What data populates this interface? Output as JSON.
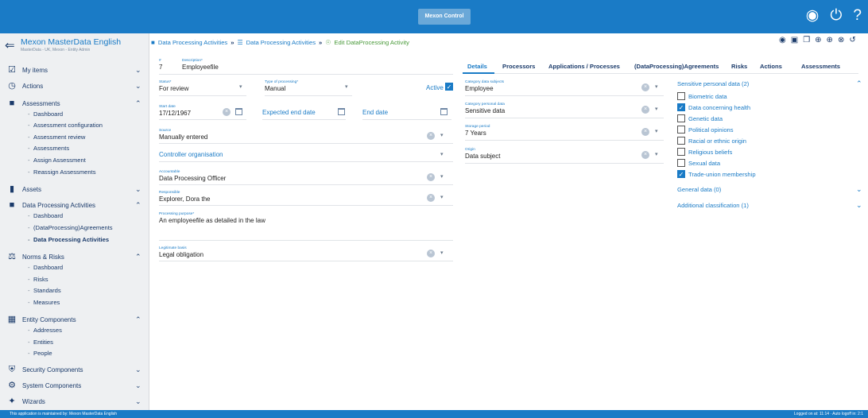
{
  "header": {
    "logo_text": "Mexon Control",
    "icons": [
      "user-icon",
      "power-icon",
      "help-icon"
    ]
  },
  "sidebar": {
    "title": "Mexon MasterData English",
    "subtitle": "MasterData - UK, Mexon - Entity Admin",
    "items": [
      {
        "label": "My items",
        "icon": "clipboard-check-icon"
      },
      {
        "label": "Actions",
        "icon": "alarm-clock-icon"
      },
      {
        "label": "Assessments",
        "icon": "chat-alert-icon",
        "sub": [
          "Dashboard",
          "Assessment configuration",
          "Assessment review",
          "Assessments",
          "Assign Assessment",
          "Reassign Assessments"
        ]
      },
      {
        "label": "Assets",
        "icon": "barcode-icon"
      },
      {
        "label": "Data Processing Activities",
        "icon": "chat-icon",
        "sub": [
          "Dashboard",
          "(DataProcessing)Agreements",
          "Data Processing Activities"
        ]
      },
      {
        "label": "Norms & Risks",
        "icon": "scale-icon",
        "sub": [
          "Dashboard",
          "Risks",
          "Standards",
          "Measures"
        ]
      },
      {
        "label": "Entity Components",
        "icon": "building-icon",
        "sub": [
          "Addresses",
          "Entities",
          "People"
        ]
      },
      {
        "label": "Security Components",
        "icon": "shield-icon"
      },
      {
        "label": "System Components",
        "icon": "gear-icon"
      },
      {
        "label": "Wizards",
        "icon": "wand-icon"
      }
    ]
  },
  "breadcrumb": {
    "items": [
      "Data Processing Activities",
      "Data Processing Activities",
      "Edit DataProcessing Activity"
    ],
    "separator": "»"
  },
  "form": {
    "number": {
      "caption": "#",
      "value": "7"
    },
    "description": {
      "caption": "Description*",
      "value": "Employeefile"
    },
    "status": {
      "caption": "Status*",
      "value": "For review"
    },
    "type": {
      "caption": "Type of processing*",
      "value": "Manual"
    },
    "active": {
      "label": "Active",
      "checked": true
    },
    "start_date": {
      "caption": "Start date",
      "value": "17/12/1967"
    },
    "expected_end_date": {
      "label": "Expected end date"
    },
    "end_date": {
      "label": "End date"
    },
    "source": {
      "caption": "Source",
      "value": "Manually entered"
    },
    "controller": {
      "label": "Controller organisation"
    },
    "accountable": {
      "caption": "Accountable",
      "value": "Data Processing Officer"
    },
    "responsible": {
      "caption": "Responsible",
      "value": "Explorer, Dora  the"
    },
    "purpose": {
      "caption": "Processing purpose*",
      "value": "An employeefile as detailed in the law"
    },
    "legitimate": {
      "caption": "Legitimate basis",
      "value": "Legal obligation"
    }
  },
  "tabs": [
    "Details",
    "Processors",
    "Applications / Processes",
    "(DataProcessing)Agreements",
    "Risks",
    "Actions",
    "Assessments"
  ],
  "details": {
    "category_subjects": {
      "caption": "Category data subjects",
      "value": "Employee"
    },
    "category_personal": {
      "caption": "Category personal data",
      "value": "Sensitive data"
    },
    "storage": {
      "caption": "Storage period",
      "value": "7 Years"
    },
    "origin": {
      "caption": "Origin",
      "value": "Data subject"
    }
  },
  "sensitive": {
    "title": "Sensitive personal data (2)",
    "items": [
      {
        "label": "Biometric data",
        "checked": false
      },
      {
        "label": "Data concerning health",
        "checked": true
      },
      {
        "label": "Genetic data",
        "checked": false
      },
      {
        "label": "Political opinions",
        "checked": false
      },
      {
        "label": "Racial or ethnic origin",
        "checked": false
      },
      {
        "label": "Religious beliefs",
        "checked": false
      },
      {
        "label": "Sexual data",
        "checked": false
      },
      {
        "label": "Trade-union membership",
        "checked": true
      }
    ],
    "general": "General data (0)",
    "additional": "Additional classification (1)"
  },
  "footer": {
    "left": "This application is maintained by: Mexon MasterData English",
    "right": "Logged on at: 11:14 · Auto logoff in: 2:1"
  },
  "colors": {
    "primary": "#1a7bc6",
    "sidebar_bg": "#eef0f2",
    "dark_text": "#1a3a6a"
  }
}
